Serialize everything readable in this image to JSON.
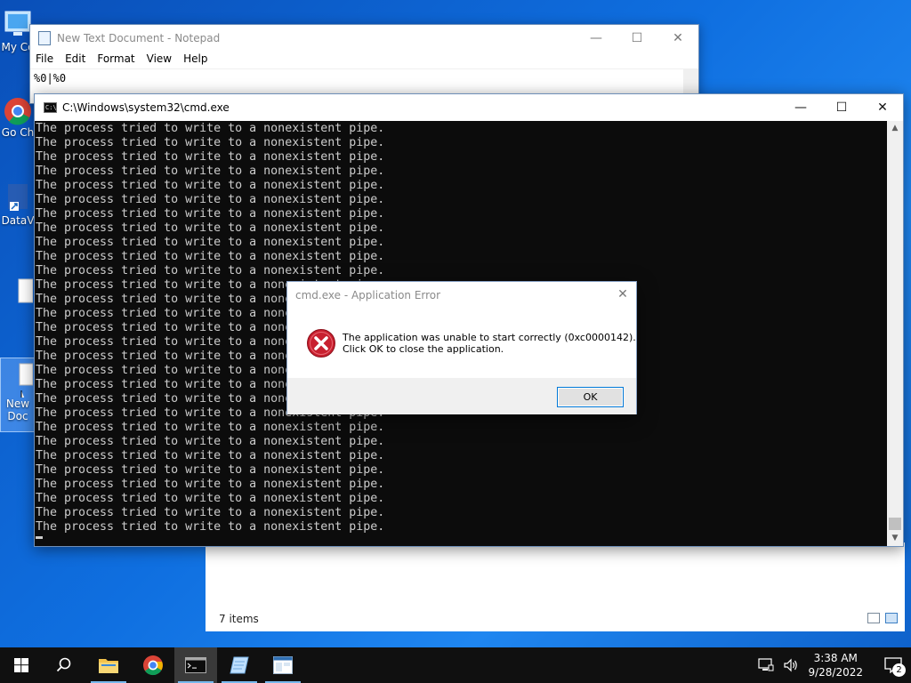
{
  "desktop": {
    "icons": [
      {
        "label": "My Co"
      },
      {
        "label": "Go Ch"
      },
      {
        "label": "DataV"
      },
      {
        "label": ""
      },
      {
        "label": "New Doc"
      }
    ]
  },
  "explorer": {
    "status_text": "7 items"
  },
  "notepad": {
    "title": "New Text Document - Notepad",
    "menu": [
      "File",
      "Edit",
      "Format",
      "View",
      "Help"
    ],
    "content": "%0|%0"
  },
  "cmd": {
    "title": "C:\\Windows\\system32\\cmd.exe",
    "lines": [
      "The process tried to write to a nonexistent pipe.",
      "The process tried to write to a nonexistent pipe.",
      "The process tried to write to a nonexistent pipe.",
      "The process tried to write to a nonexistent pipe.",
      "The process tried to write to a nonexistent pipe.",
      "The process tried to write to a nonexistent pipe.",
      "The process tried to write to a nonexistent pipe.",
      "The process tried to write to a nonexistent pipe.",
      "The process tried to write to a nonexistent pipe.",
      "The process tried to write to a nonexistent pipe.",
      "The process tried to write to a nonexistent pipe.",
      "The process tried to write to a nonexistent pipe.",
      "The process tried to write to a nonexistent pipe.",
      "The process tried to write to a nonexistent pipe.",
      "The process tried to write to a nonexistent pipe.",
      "The process tried to write to a nonexistent pipe.",
      "The process tried to write to a nonexistent pipe.",
      "The process tried to write to a nonexistent pipe.",
      "The process tried to write to a nonexistent pipe.",
      "The process tried to write to a nonexistent pipe.",
      "The process tried to write to a nonexistent pipe.",
      "The process tried to write to a nonexistent pipe.",
      "The process tried to write to a nonexistent pipe.",
      "The process tried to write to a nonexistent pipe.",
      "The process tried to write to a nonexistent pipe.",
      "The process tried to write to a nonexistent pipe.",
      "The process tried to write to a nonexistent pipe.",
      "The process tried to write to a nonexistent pipe.",
      "The process tried to write to a nonexistent pipe."
    ]
  },
  "dialog": {
    "title": "cmd.exe - Application Error",
    "message_line1": "The application was unable to start correctly (0xc0000142).",
    "message_line2": "Click OK to close the application.",
    "ok_label": "OK",
    "icon": "error-icon"
  },
  "taskbar": {
    "pinned": [
      "start-icon",
      "search-icon",
      "file-explorer-icon",
      "chrome-icon",
      "cmd-icon",
      "notepad-icon",
      "explorer-window-icon"
    ],
    "time": "3:38 AM",
    "date": "9/28/2022",
    "notification_count": "2"
  }
}
